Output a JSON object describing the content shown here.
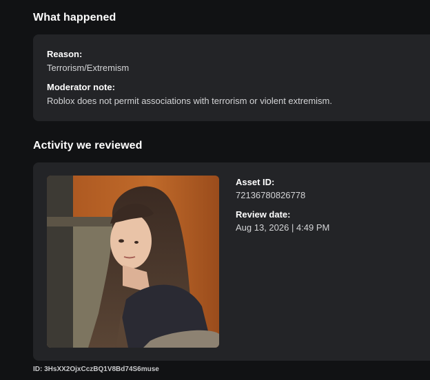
{
  "what_happened": {
    "title": "What happened",
    "reason_label": "Reason:",
    "reason_value": "Terrorism/Extremism",
    "note_label": "Moderator note:",
    "note_value": "Roblox does not permit associations with terrorism or violent extremism."
  },
  "activity": {
    "title": "Activity we reviewed",
    "asset_label": "Asset ID:",
    "asset_value": "72136780826778",
    "date_label": "Review date:",
    "date_value": "Aug 13, 2026 | 4:49 PM"
  },
  "footer": {
    "id_text": "ID: 3HsXX2OjxCczBQ1V8Bd74S6muse"
  }
}
